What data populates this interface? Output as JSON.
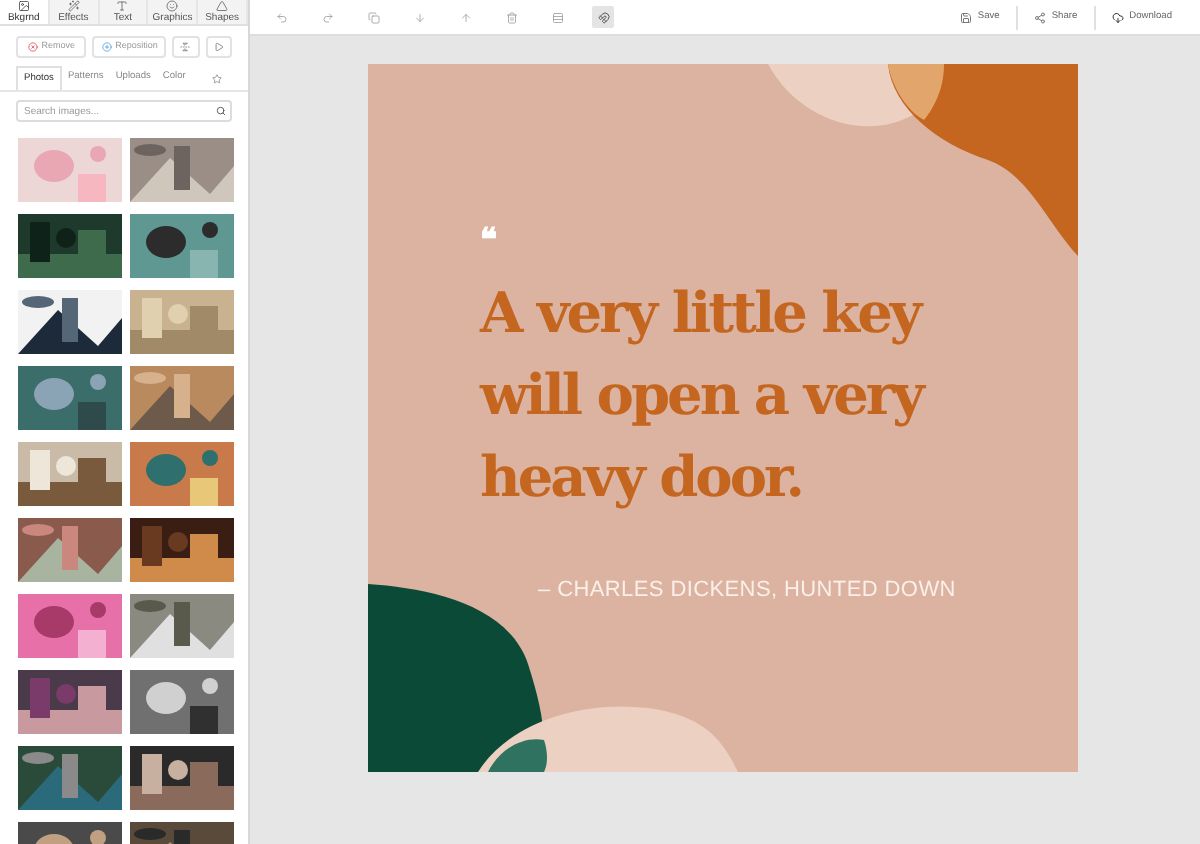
{
  "sidebar": {
    "tabs": [
      {
        "label": "Bkgrnd",
        "selected": true
      },
      {
        "label": "Effects",
        "selected": false
      },
      {
        "label": "Text",
        "selected": false
      },
      {
        "label": "Graphics",
        "selected": false
      },
      {
        "label": "Shapes",
        "selected": false
      }
    ],
    "actions": [
      {
        "label": "Remove"
      },
      {
        "label": "Reposition"
      }
    ],
    "subtabs": [
      {
        "label": "Photos",
        "selected": true
      },
      {
        "label": "Patterns",
        "selected": false
      },
      {
        "label": "Uploads",
        "selected": false
      },
      {
        "label": "Color",
        "selected": false
      }
    ],
    "search": {
      "placeholder": "Search images..."
    }
  },
  "toolbar": {
    "tools": [
      {
        "selected": false
      },
      {
        "selected": false
      },
      {
        "selected": false
      },
      {
        "selected": false
      },
      {
        "selected": false
      },
      {
        "selected": false
      },
      {
        "selected": false
      },
      {
        "selected": true
      }
    ],
    "actions": [
      {
        "label": "Save"
      },
      {
        "label": "Share"
      },
      {
        "label": "Download"
      }
    ]
  },
  "canvas": {
    "quote_mark": "❝",
    "quote": "A very little key will open a very heavy door.",
    "author": "– CHARLES DICKENS, HUNTED DOWN"
  }
}
